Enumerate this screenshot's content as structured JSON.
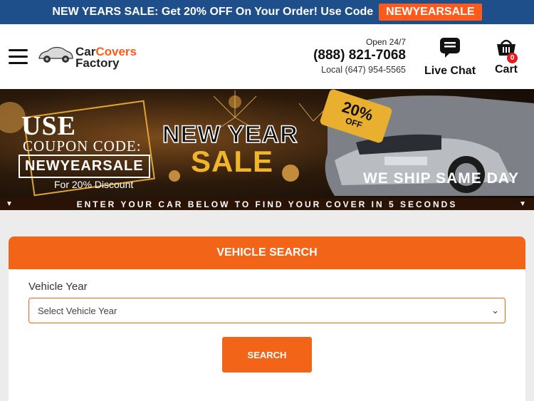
{
  "promo": {
    "text": "NEW YEARS SALE: Get 20% OFF On Your Order! Use Code",
    "code": "NEWYEARSALE"
  },
  "header": {
    "menu_icon": "hamburger-menu-icon",
    "logo_line1_a": "Car",
    "logo_line1_b": "Covers",
    "logo_line2": "Factory",
    "open_hours": "Open 24/7",
    "phone": "(888) 821-7068",
    "local_phone": "Local (647) 954-5565",
    "chat_label": "Live Chat",
    "chat_icon": "chat-bubble-icon",
    "cart_label": "Cart",
    "cart_icon": "basket-icon",
    "cart_count": "0"
  },
  "banner": {
    "use": "USE",
    "coupon_label": "COUPON CODE:",
    "coupon_code": "NEWYEARSALE",
    "discount_text": "For 20% Discount",
    "headline_1": "NEW YEAR",
    "headline_2": "SALE",
    "tag_percent": "20%",
    "tag_off": "OFF",
    "ship_text": "WE SHIP SAME DAY",
    "strip_text": "ENTER YOUR CAR BELOW TO FIND YOUR COVER IN 5 SECONDS"
  },
  "vehicle_search": {
    "title": "VEHICLE SEARCH",
    "year_label": "Vehicle Year",
    "year_placeholder": "Select Vehicle Year",
    "search_button": "SEARCH"
  },
  "colors": {
    "promo_bg": "#1f4f8b",
    "accent": "#f26417",
    "badge": "#e41b1b"
  }
}
